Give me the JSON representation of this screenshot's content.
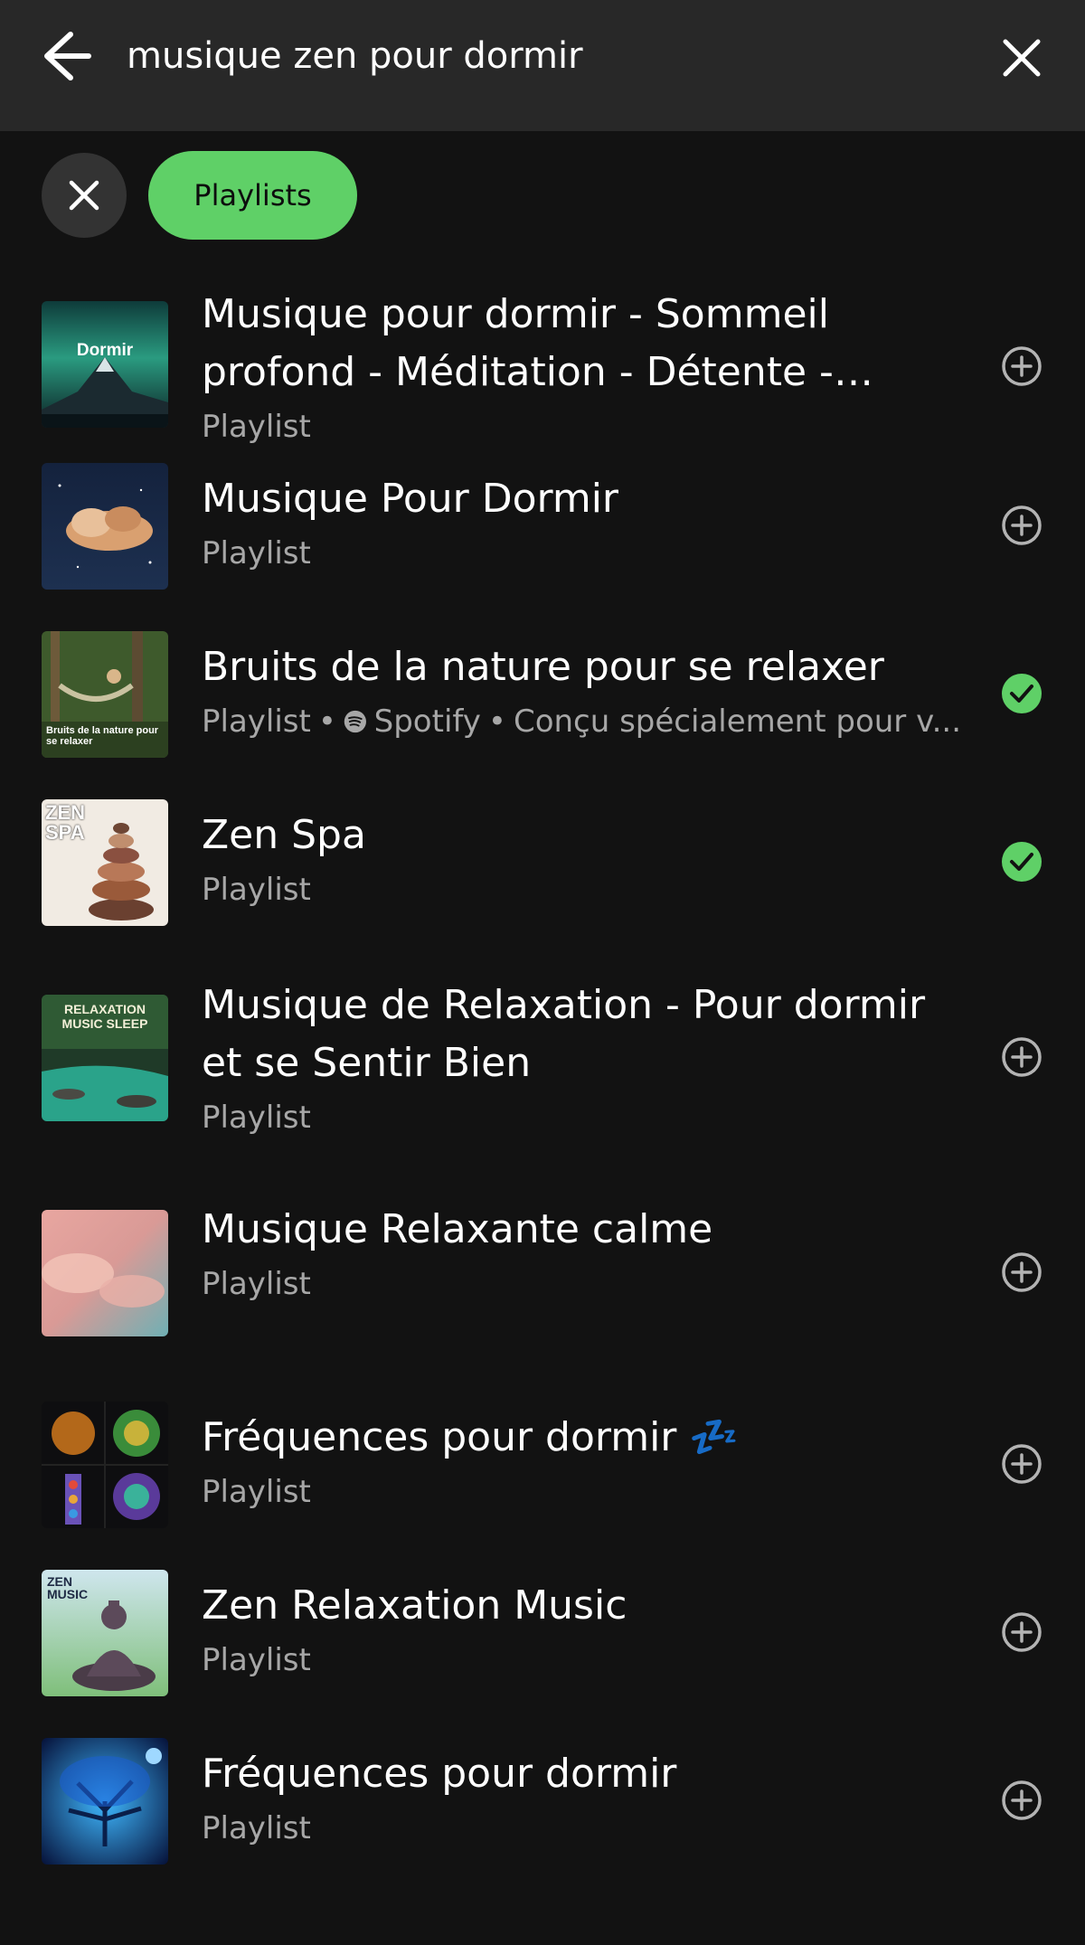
{
  "search": {
    "query": "musique zen pour dormir"
  },
  "filters": {
    "active_chip": "Playlists"
  },
  "results": [
    {
      "title": "Musique pour dormir - Sommeil profond - Méditation - Détente - Rela...",
      "subtitle": "Playlist",
      "cover_text": "Dormir",
      "action": "add"
    },
    {
      "title": "Musique Pour Dormir",
      "subtitle": "Playlist",
      "action": "add"
    },
    {
      "title": "Bruits de la nature pour se relaxer",
      "subtitle": "Playlist",
      "owner": "Spotify",
      "description": "Conçu spécialement pour v...",
      "cover_text": "Bruits de la nature pour se relaxer",
      "action": "added"
    },
    {
      "title": "Zen Spa",
      "subtitle": "Playlist",
      "cover_text": "ZEN SPA",
      "action": "added"
    },
    {
      "title": "Musique de Relaxation - Pour dormir et se Sentir Bien",
      "subtitle": "Playlist",
      "cover_text": "RELAXATION MUSIC SLEEP",
      "action": "add"
    },
    {
      "title": "Musique Relaxante calme",
      "subtitle": "Playlist",
      "action": "add"
    },
    {
      "title": "Fréquences pour dormir 💤",
      "subtitle": "Playlist",
      "action": "add"
    },
    {
      "title": "Zen Relaxation Music",
      "subtitle": "Playlist",
      "cover_text": "ZEN MUSIC",
      "action": "add"
    },
    {
      "title": "Fréquences pour dormir",
      "subtitle": "Playlist",
      "action": "add"
    }
  ],
  "icons": {
    "back": "arrow-left-icon",
    "clear": "close-icon",
    "add": "plus-circle-icon",
    "added": "check-circle-icon",
    "spotify": "spotify-logo-icon"
  },
  "colors": {
    "accent": "#5fd067",
    "background": "#121212",
    "topbar": "#282828",
    "secondary_text": "#a7a7a7"
  }
}
